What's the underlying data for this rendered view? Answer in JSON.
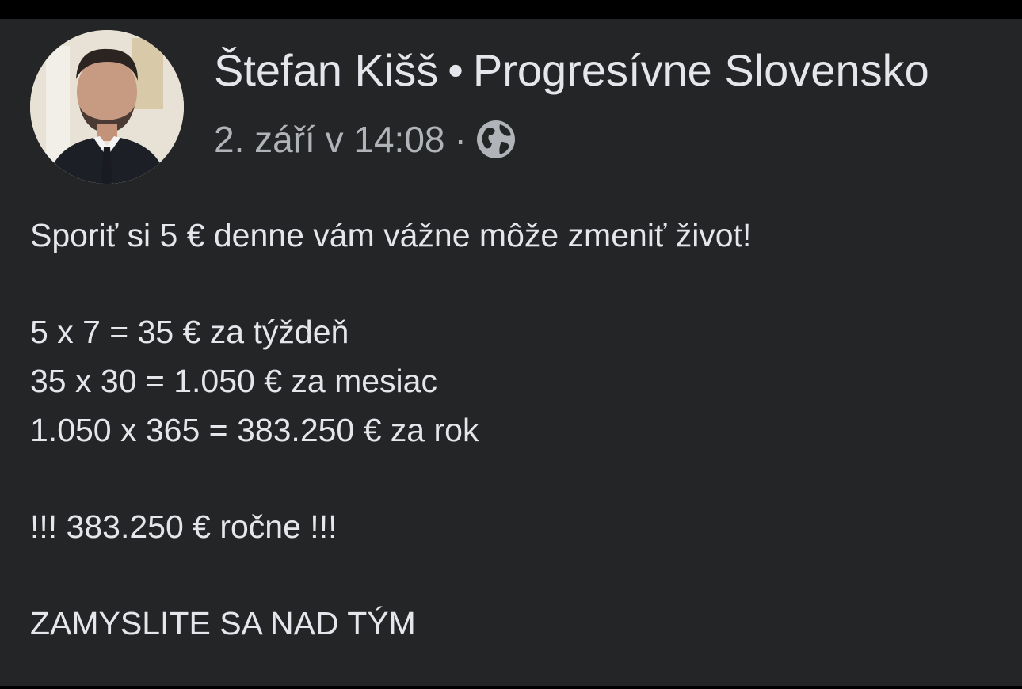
{
  "post": {
    "author": "Štefan Kišš",
    "separator": "•",
    "page": "Progresívne Slovensko",
    "timestamp": "2. září v 14:08",
    "meta_separator": "·",
    "privacy_icon": "globe-icon",
    "lines": {
      "intro": "Sporiť si 5 € denne vám vážne môže zmeniť život!",
      "calc_week": "5 x 7 = 35 € za týždeň",
      "calc_month": "35 x 30 = 1.050 € za mesiac",
      "calc_year": "1.050 x 365 = 383.250 € za rok",
      "result": "!!! 383.250 € ročne !!!",
      "outro": "ZAMYSLITE SA NAD TÝM"
    }
  },
  "colors": {
    "page_background": "#000000",
    "card_background": "#242526",
    "primary_text": "#e4e6eb",
    "secondary_text": "#b0b3b8"
  }
}
